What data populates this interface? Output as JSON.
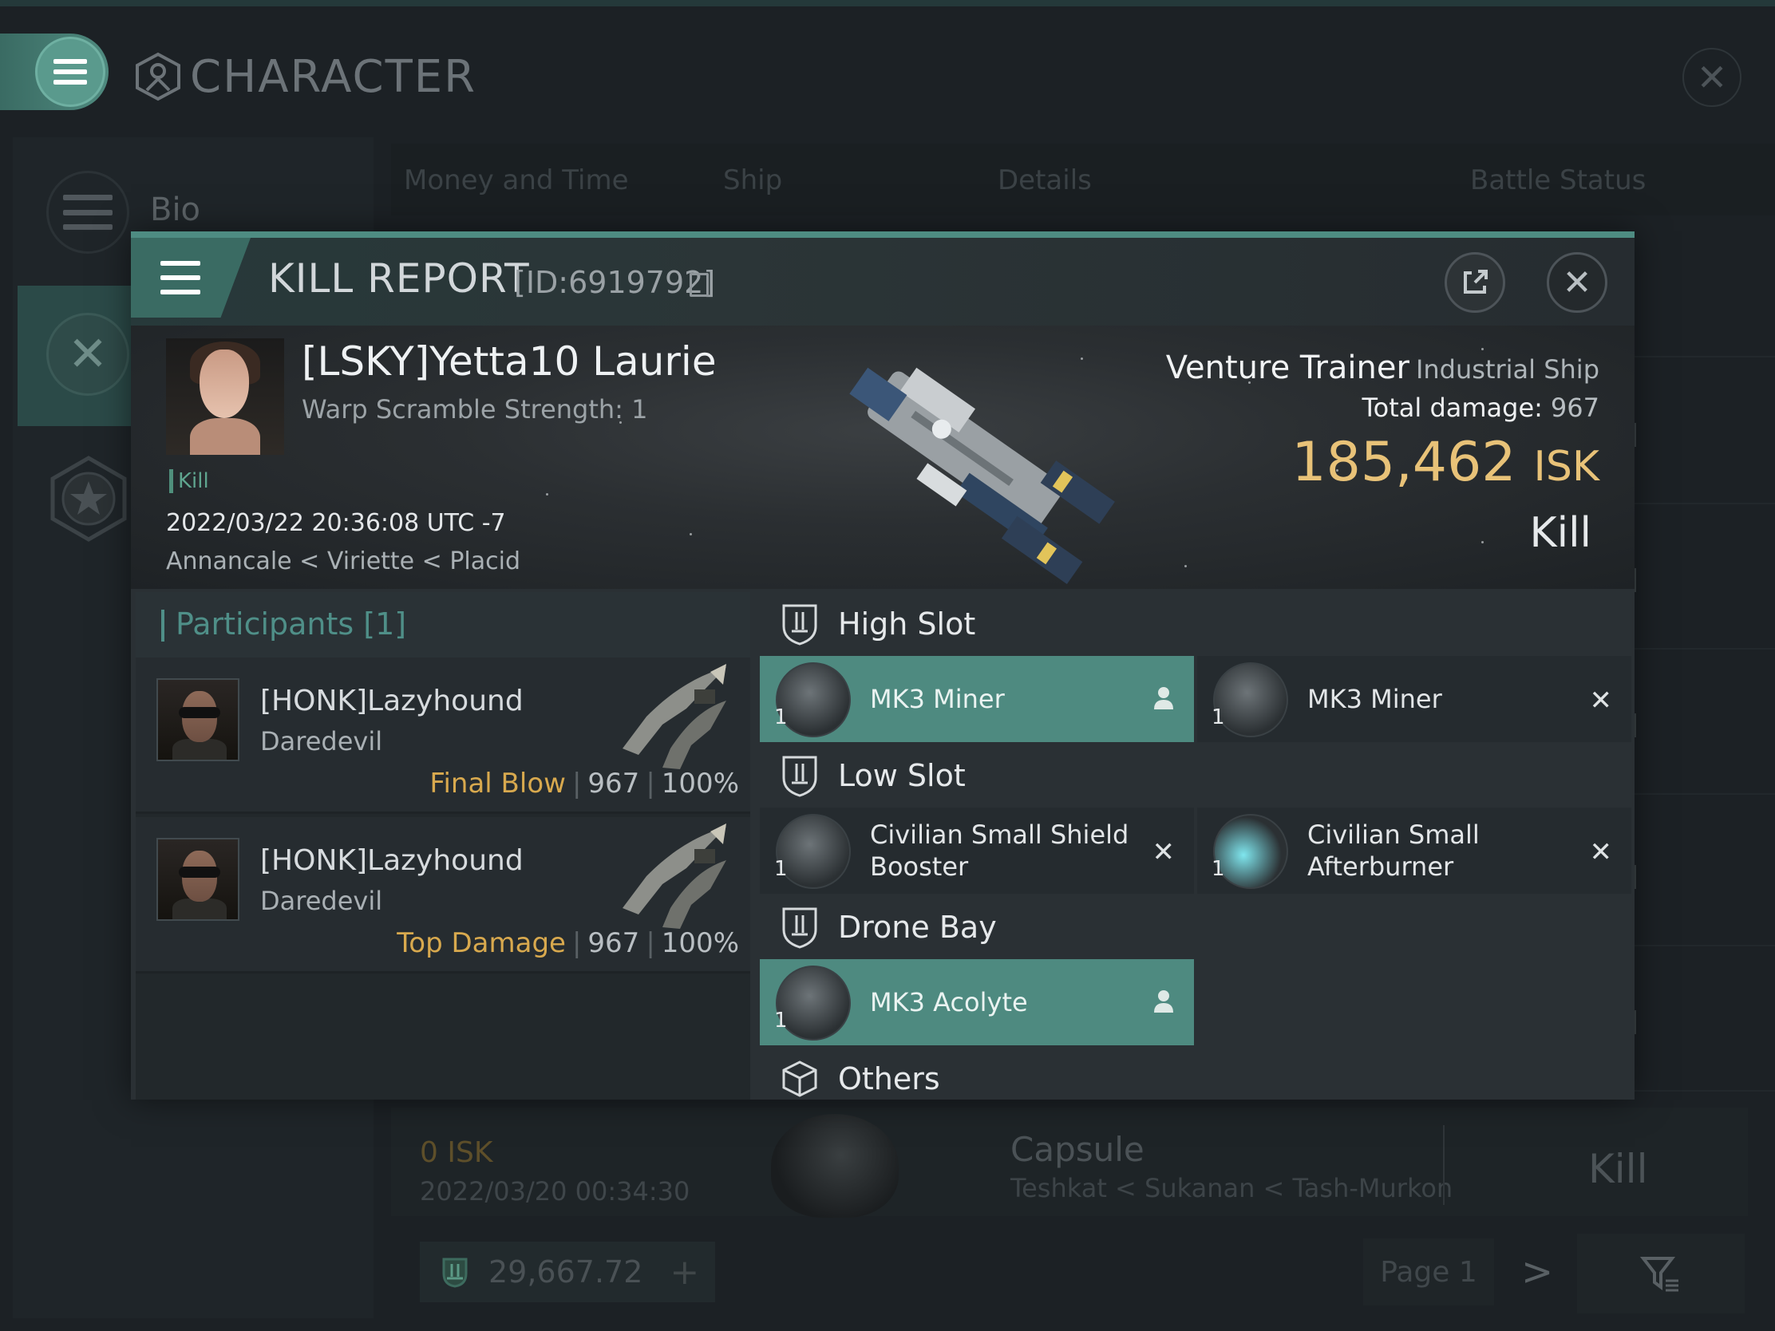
{
  "app": {
    "window_title": "CHARACTER",
    "close_icon": "close-icon"
  },
  "background": {
    "nav": {
      "bio_label": "Bio",
      "items": [
        "bio-icon",
        "crossed-swords-icon",
        "star-badge-icon"
      ]
    },
    "tabs": [
      "Money and Time",
      "Ship",
      "Details",
      "Battle Status"
    ],
    "previous_kill": {
      "isk": "0  ISK",
      "date": "2022/03/20  00:34:30",
      "ship": "Capsule",
      "location": "Teshkat < Sukanan < Tash-Murkon",
      "result": "Kill"
    },
    "wallet": {
      "value": "29,667.72",
      "add": "+"
    },
    "pagination": {
      "page_label": "Page 1",
      "next": ">"
    }
  },
  "kill_report": {
    "title": "KILL REPORT",
    "id_label": "[ID:6919792]",
    "victim": {
      "name": "[LSKY]Yetta10 Laurie",
      "warp_scramble": "Warp Scramble Strength: 1",
      "tag": "Kill",
      "datetime": "2022/03/22 20:36:08 UTC -7",
      "location": "Annancale < Viriette < Placid"
    },
    "ship": {
      "name": "Venture Trainer",
      "class": "Industrial Ship",
      "total_damage_label": "Total damage:",
      "total_damage": "967",
      "isk_value": "185,462",
      "isk_unit": "ISK",
      "result": "Kill"
    },
    "participants": {
      "header": "Participants [1]",
      "rows": [
        {
          "name": "[HONK]Lazyhound",
          "ship": "Daredevil",
          "label": "Final Blow",
          "damage": "967",
          "percent": "100%"
        },
        {
          "name": "[HONK]Lazyhound",
          "ship": "Daredevil",
          "label": "Top Damage",
          "damage": "967",
          "percent": "100%"
        }
      ],
      "separator": "|"
    },
    "fitting": {
      "high_slot": {
        "title": "High Slot",
        "modules": [
          {
            "name": "MK3 Miner",
            "qty": "1",
            "status": "dropped",
            "status_icon": "person-icon"
          },
          {
            "name": "MK3 Miner",
            "qty": "1",
            "status": "destroyed",
            "status_icon": "x-icon"
          }
        ]
      },
      "low_slot": {
        "title": "Low Slot",
        "modules": [
          {
            "name": "Civilian Small Shield Booster",
            "qty": "1",
            "status": "destroyed",
            "status_icon": "x-icon"
          },
          {
            "name": "Civilian Small Afterburner",
            "qty": "1",
            "status": "destroyed",
            "status_icon": "x-icon"
          }
        ]
      },
      "drone_bay": {
        "title": "Drone Bay",
        "modules": [
          {
            "name": "MK3  Acolyte",
            "qty": "1",
            "status": "dropped",
            "status_icon": "person-icon"
          }
        ]
      },
      "others": {
        "title": "Others"
      }
    }
  },
  "colors": {
    "accent_teal": "#4e8a80",
    "isk_gold": "#e8c278",
    "final_blow": "#d8a94e"
  }
}
